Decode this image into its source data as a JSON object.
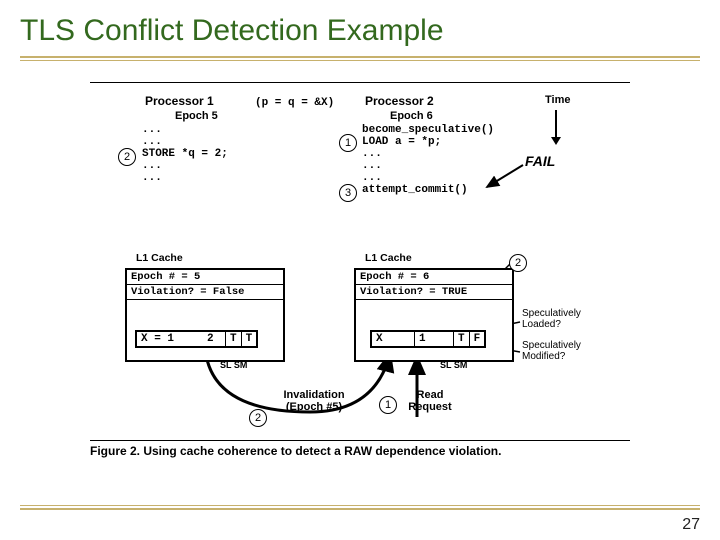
{
  "slide": {
    "title": "TLS Conflict Detection Example",
    "page_number": "27"
  },
  "figure": {
    "proc1": {
      "name": "Processor 1",
      "epoch_label": "Epoch 5",
      "code_1": "...",
      "code_2": "...",
      "code_store": "STORE *q = 2;",
      "code_3": "...",
      "code_4": "..."
    },
    "shared_pq": "(p = q = &X)",
    "proc2": {
      "name": "Processor 2",
      "epoch_label": "Epoch 6",
      "code_become": "become_speculative()",
      "code_load": "LOAD a = *p;",
      "code_1": "...",
      "code_2": "...",
      "code_3": "...",
      "code_attempt": "attempt_commit()"
    },
    "time_label": "Time",
    "fail_label": "FAIL",
    "cache1": {
      "title": "L1 Cache",
      "epoch": "Epoch # = 5",
      "violation": "Violation? = False",
      "line_x": "X = 1 → 2",
      "line_t1": "T",
      "line_t2": "T"
    },
    "cache2": {
      "title": "L1 Cache",
      "epoch": "Epoch # = 6",
      "violation": "Violation? = TRUE",
      "line_x": "X",
      "line_v": "1",
      "line_sl": "T",
      "line_sm": "F"
    },
    "slsm_label": "SL SM",
    "spec_loaded": "Speculatively Loaded?",
    "spec_modified": "Speculatively Modified?",
    "invalidation": "Invalidation (Epoch #5)",
    "read_request": "Read Request",
    "circle1": "1",
    "circle2": "2",
    "circle3": "3",
    "caption_bold": "Figure 2. Using cache coherence to detect a RAW dependence violation.",
    "caption_rest": ""
  }
}
